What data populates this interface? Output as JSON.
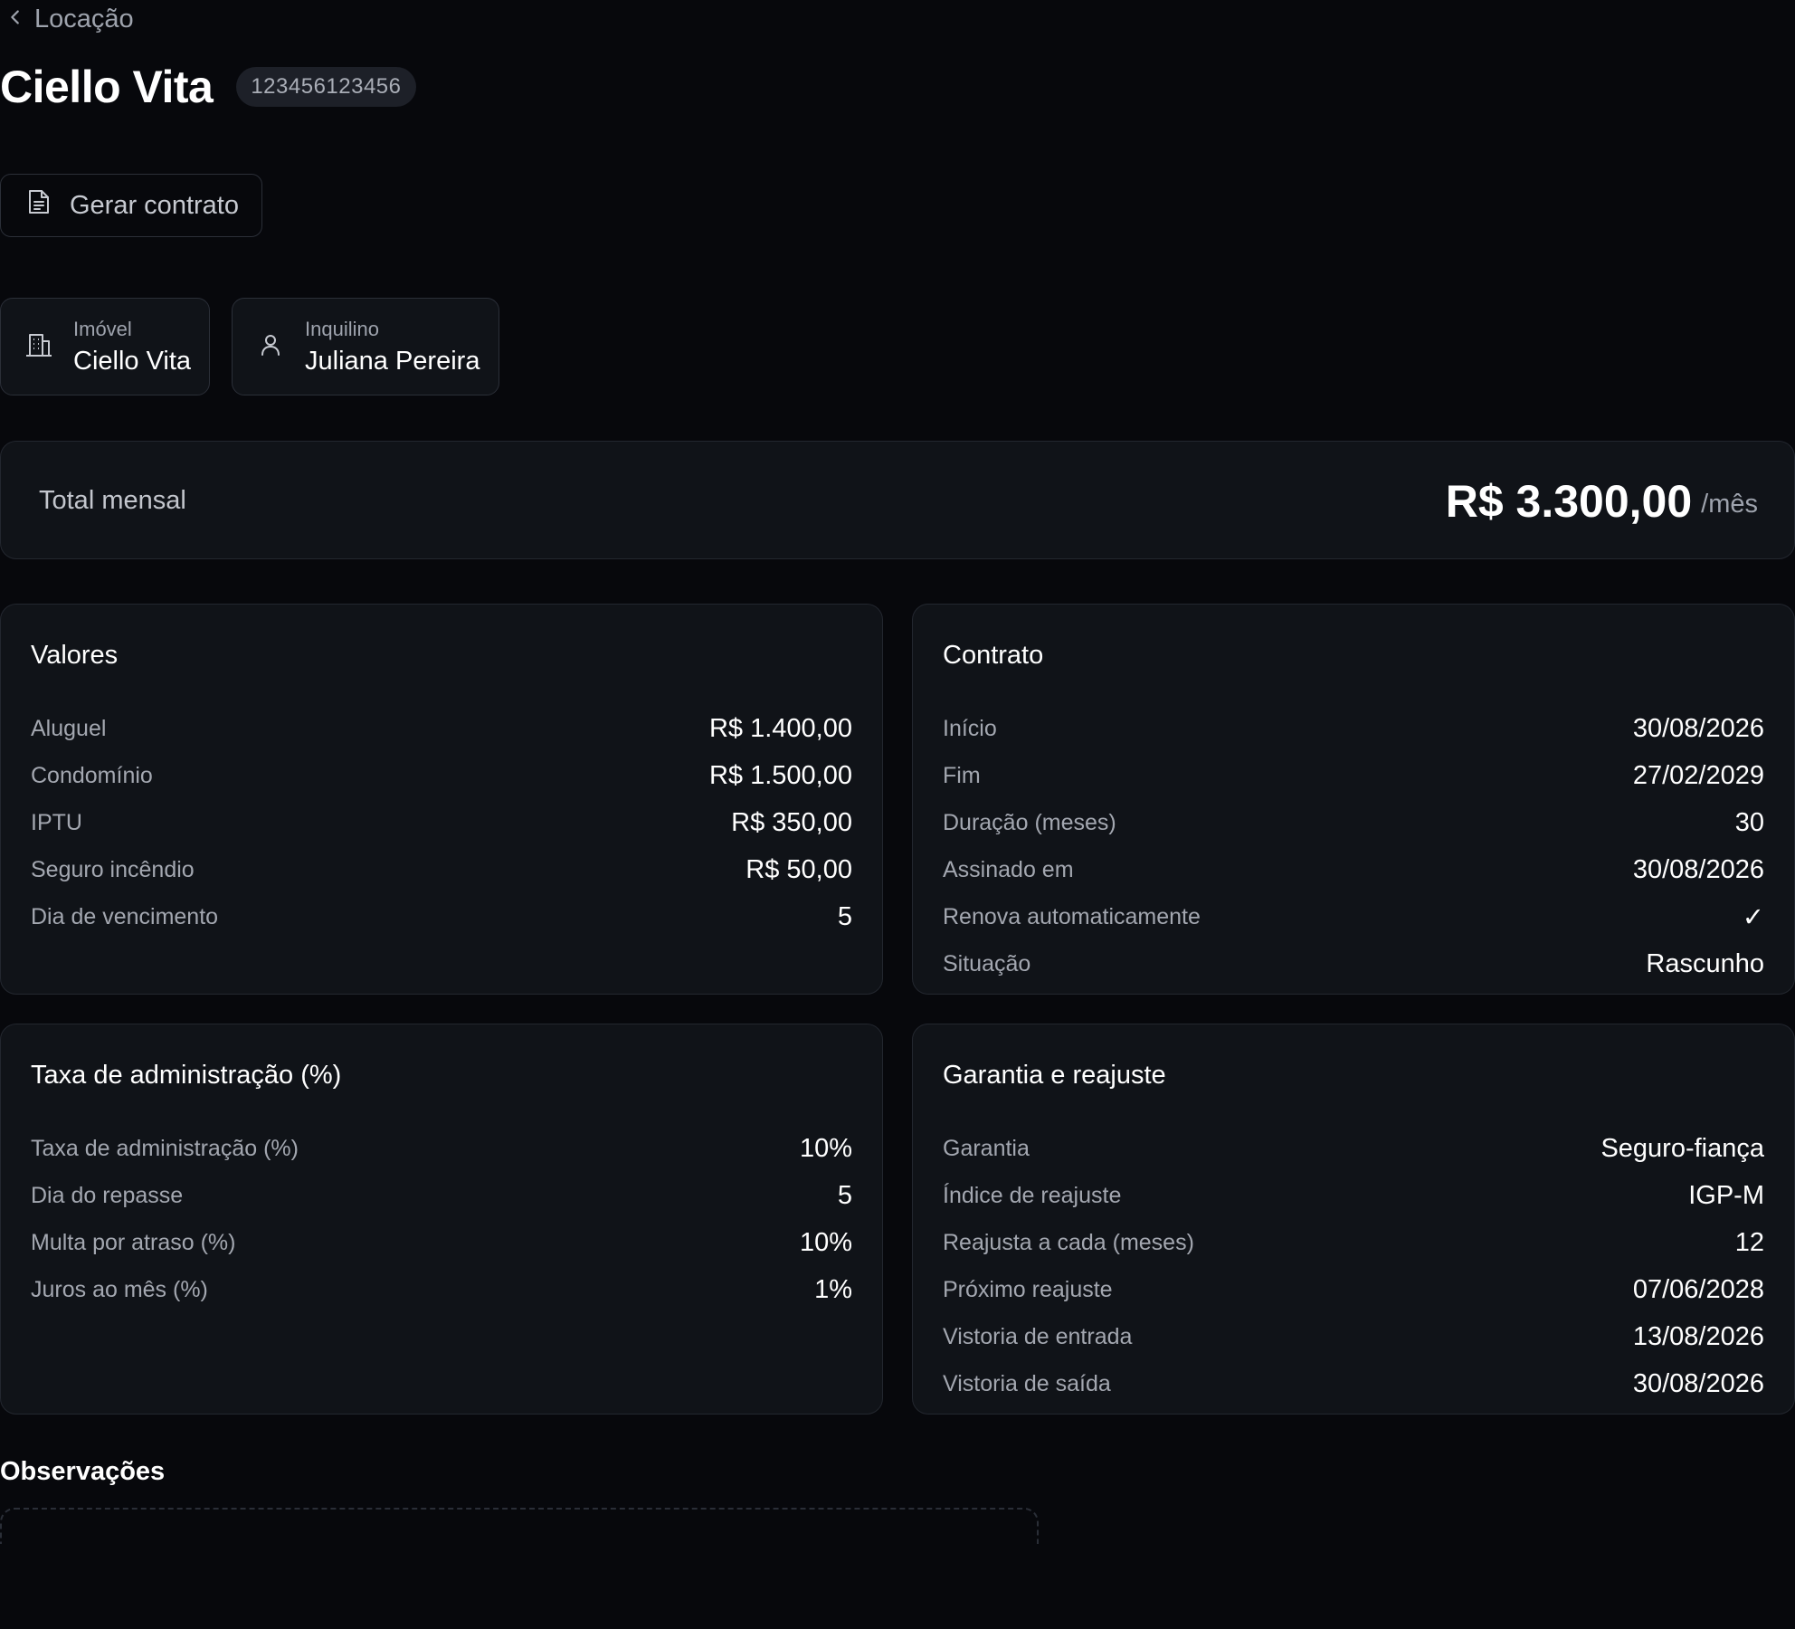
{
  "breadcrumb": {
    "label": "Locação"
  },
  "header": {
    "title": "Ciello Vita",
    "id_badge": "123456123456"
  },
  "actions": {
    "generate_contract": "Gerar contrato"
  },
  "chips": {
    "imovel": {
      "label": "Imóvel",
      "value": "Ciello Vita",
      "icon": "building-icon"
    },
    "inquilino": {
      "label": "Inquilino",
      "value": "Juliana Pereira",
      "icon": "user-icon"
    }
  },
  "total": {
    "label": "Total mensal",
    "value": "R$ 3.300,00",
    "suffix": "/mês"
  },
  "valores": {
    "title": "Valores",
    "rows": [
      {
        "label": "Aluguel",
        "value": "R$ 1.400,00"
      },
      {
        "label": "Condomínio",
        "value": "R$ 1.500,00"
      },
      {
        "label": "IPTU",
        "value": "R$ 350,00"
      },
      {
        "label": "Seguro incêndio",
        "value": "R$ 50,00"
      },
      {
        "label": "Dia de vencimento",
        "value": "5"
      }
    ]
  },
  "contrato": {
    "title": "Contrato",
    "rows": [
      {
        "label": "Início",
        "value": "30/08/2026"
      },
      {
        "label": "Fim",
        "value": "27/02/2029"
      },
      {
        "label": "Duração (meses)",
        "value": "30"
      },
      {
        "label": "Assinado em",
        "value": "30/08/2026"
      },
      {
        "label": "Renova automaticamente",
        "value": "✓"
      },
      {
        "label": "Situação",
        "value": "Rascunho"
      }
    ]
  },
  "taxa": {
    "title": "Taxa de administração (%)",
    "rows": [
      {
        "label": "Taxa de administração (%)",
        "value": "10%"
      },
      {
        "label": "Dia do repasse",
        "value": "5"
      },
      {
        "label": "Multa por atraso (%)",
        "value": "10%"
      },
      {
        "label": "Juros ao mês (%)",
        "value": "1%"
      }
    ]
  },
  "garantia": {
    "title": "Garantia e reajuste",
    "rows": [
      {
        "label": "Garantia",
        "value": "Seguro-fiança"
      },
      {
        "label": "Índice de reajuste",
        "value": "IGP-M"
      },
      {
        "label": "Reajusta a cada (meses)",
        "value": "12"
      },
      {
        "label": "Próximo reajuste",
        "value": "07/06/2028"
      },
      {
        "label": "Vistoria de entrada",
        "value": "13/08/2026"
      },
      {
        "label": "Vistoria de saída",
        "value": "30/08/2026"
      }
    ]
  },
  "observacoes": {
    "title": "Observações"
  }
}
